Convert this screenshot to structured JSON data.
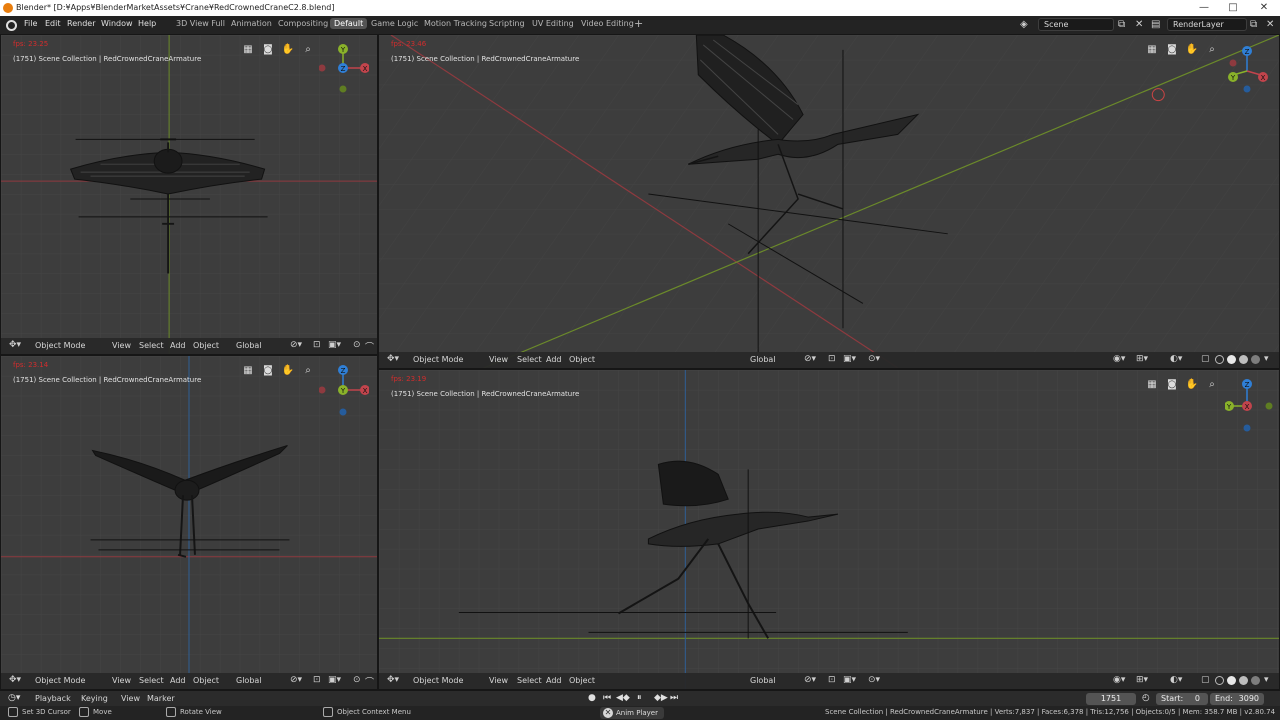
{
  "window": {
    "title": "Blender* [D:¥Apps¥BlenderMarketAssets¥Crane¥RedCrownedCraneC2.8.blend]",
    "minimize": "—",
    "maximize": "□",
    "close": "✕"
  },
  "menu": [
    "File",
    "Edit",
    "Render",
    "Window",
    "Help"
  ],
  "workspaces": [
    {
      "label": "3D View Full",
      "active": false
    },
    {
      "label": "Animation",
      "active": false
    },
    {
      "label": "Compositing",
      "active": false
    },
    {
      "label": "Default",
      "active": true
    },
    {
      "label": "Game Logic",
      "active": false
    },
    {
      "label": "Motion Tracking",
      "active": false
    },
    {
      "label": "Scripting",
      "active": false
    },
    {
      "label": "UV Editing",
      "active": false
    },
    {
      "label": "Video Editing",
      "active": false
    }
  ],
  "add_workspace": "+",
  "scene": {
    "label": "Scene"
  },
  "view_layer": {
    "label": "RenderLayer"
  },
  "viewports": [
    {
      "fps": "fps: 23.25",
      "collection": "(1751) Scene Collection | RedCrownedCraneArmature",
      "header": {
        "mode": "Object Mode",
        "view": "View",
        "select": "Select",
        "add": "Add",
        "object": "Object",
        "orientation": "Global"
      },
      "gizmo": [
        "Y",
        "Z",
        "X"
      ]
    },
    {
      "fps": "fps: 23.46",
      "collection": "(1751) Scene Collection | RedCrownedCraneArmature",
      "header": {
        "mode": "Object Mode",
        "view": "View",
        "select": "Select",
        "add": "Add",
        "object": "Object",
        "orientation": "Global"
      },
      "gizmo": [
        "Z",
        "Y",
        "X"
      ]
    },
    {
      "fps": "fps: 23.14",
      "collection": "(1751) Scene Collection | RedCrownedCraneArmature",
      "header": {
        "mode": "Object Mode",
        "view": "View",
        "select": "Select",
        "add": "Add",
        "object": "Object",
        "orientation": "Global"
      },
      "gizmo": [
        "Z",
        "Y",
        "X"
      ]
    },
    {
      "fps": "fps: 23.19",
      "collection": "(1751) Scene Collection | RedCrownedCraneArmature",
      "header": {
        "mode": "Object Mode",
        "view": "View",
        "select": "Select",
        "add": "Add",
        "object": "Object",
        "orientation": "Global"
      },
      "gizmo": [
        "Z",
        "Y",
        "X"
      ]
    }
  ],
  "timeline": {
    "playback": "Playback",
    "keying": "Keying",
    "view": "View",
    "marker": "Marker",
    "current_frame": "1751",
    "start_label": "Start:",
    "start_value": "0",
    "end_label": "End:",
    "end_value": "3090"
  },
  "status": {
    "set_cursor": "Set 3D Cursor",
    "move": "Move",
    "rotate": "Rotate View",
    "context_menu": "Object Context Menu",
    "anim_player": "Anim Player",
    "stats": "Scene Collection | RedCrownedCraneArmature | Verts:7,837 | Faces:6,378 | Tris:12,756 | Objects:0/5 | Mem: 358.7 MB | v2.80.74"
  },
  "icons": {
    "nav": [
      "grid-icon",
      "camera-icon",
      "hand-icon",
      "zoom-icon"
    ],
    "shading": [
      "wireframe-icon",
      "solid-icon",
      "material-icon",
      "rendered-icon"
    ]
  },
  "colors": {
    "x_axis": "#c2444c",
    "y_axis": "#8ab22a",
    "z_axis": "#2f7fd6",
    "active_workspace": "#545454",
    "fps_text": "#d22d2d"
  }
}
